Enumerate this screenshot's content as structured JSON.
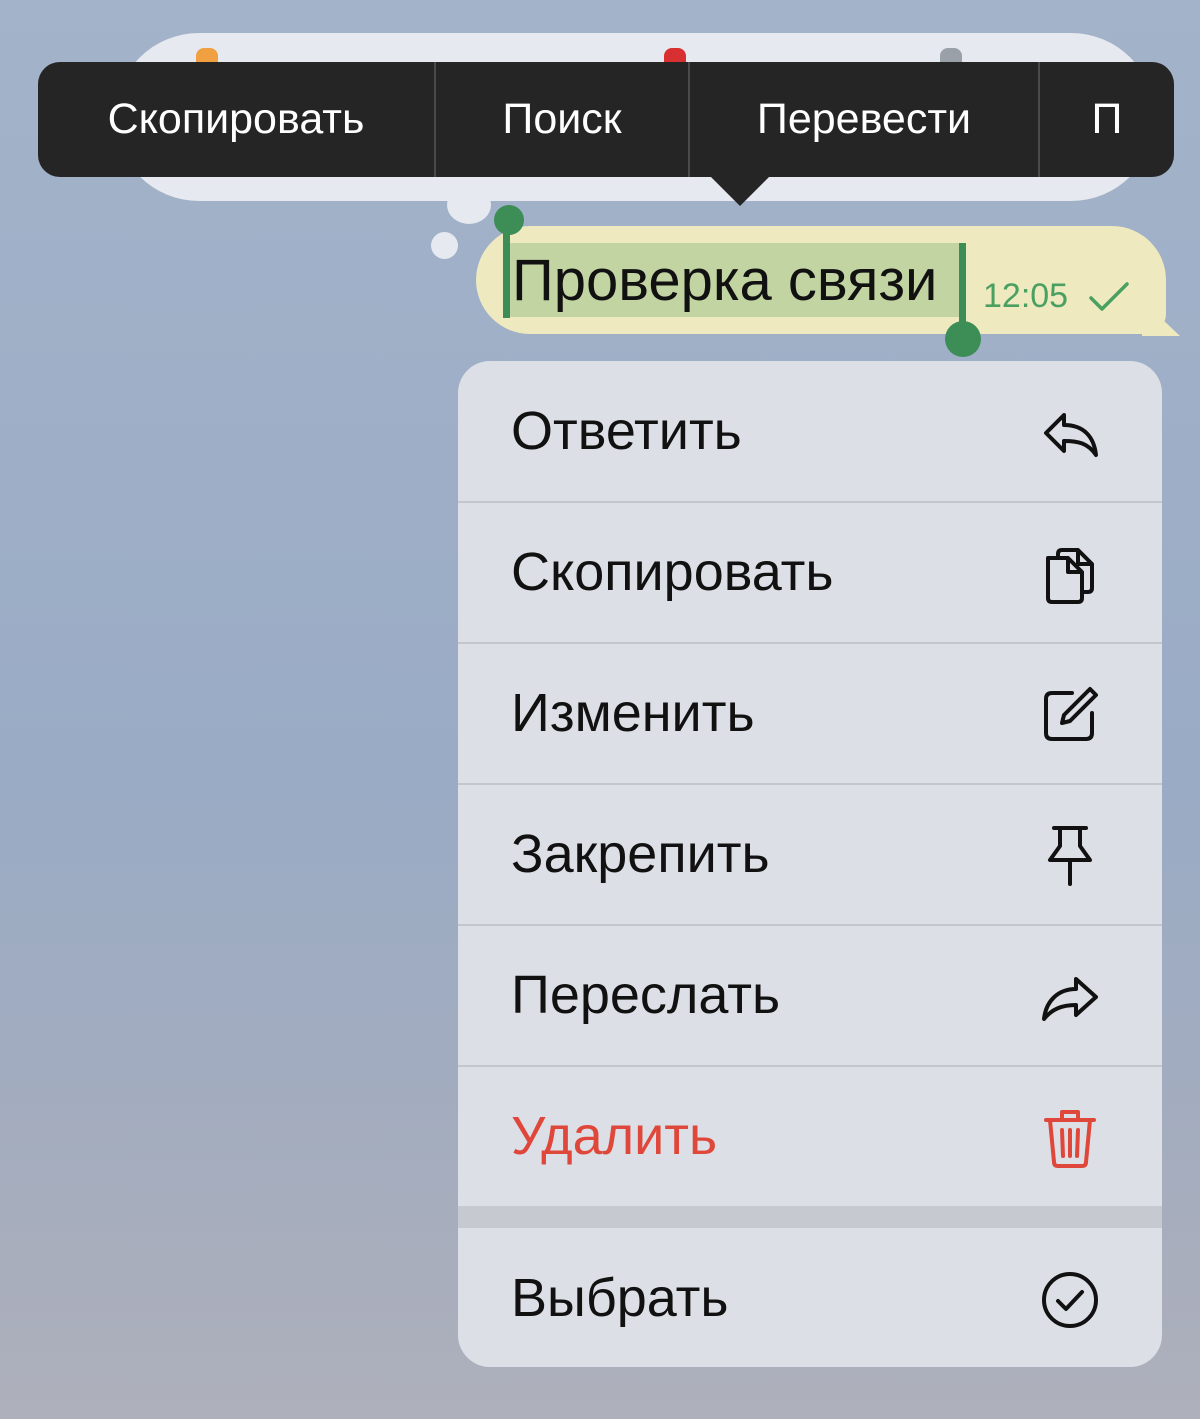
{
  "edit_menu": {
    "items": [
      {
        "label": "Скопировать"
      },
      {
        "label": "Поиск"
      },
      {
        "label": "Перевести"
      },
      {
        "label": "П"
      }
    ]
  },
  "message": {
    "text": "Проверка связи",
    "time": "12:05",
    "status_icon": "check-icon",
    "selected": true
  },
  "context_menu": {
    "items": [
      {
        "label": "Ответить",
        "icon": "reply-icon"
      },
      {
        "label": "Скопировать",
        "icon": "copy-icon"
      },
      {
        "label": "Изменить",
        "icon": "edit-icon"
      },
      {
        "label": "Закрепить",
        "icon": "pin-icon"
      },
      {
        "label": "Переслать",
        "icon": "forward-icon"
      },
      {
        "label": "Удалить",
        "icon": "trash-icon",
        "color": "#e0473b"
      }
    ],
    "secondary": {
      "label": "Выбрать",
      "icon": "select-circle-check-icon"
    }
  },
  "colors": {
    "accent_green": "#3d8d57",
    "danger": "#e0473b",
    "bubble": "#eee9bf",
    "menu_bg": "#dcdfe5",
    "edit_menu_bg": "#252526"
  }
}
